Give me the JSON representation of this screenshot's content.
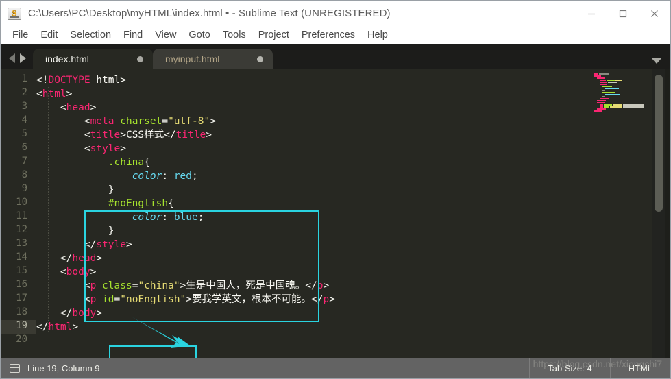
{
  "window": {
    "title": "C:\\Users\\PC\\Desktop\\myHTML\\index.html • - Sublime Text (UNREGISTERED)",
    "app_icon": "sublime-logo-icon",
    "controls": {
      "minimize": "minimize-icon",
      "maximize": "maximize-icon",
      "close": "close-icon"
    }
  },
  "menubar": {
    "items": [
      {
        "label": "File"
      },
      {
        "label": "Edit"
      },
      {
        "label": "Selection"
      },
      {
        "label": "Find"
      },
      {
        "label": "View"
      },
      {
        "label": "Goto"
      },
      {
        "label": "Tools"
      },
      {
        "label": "Project"
      },
      {
        "label": "Preferences"
      },
      {
        "label": "Help"
      }
    ]
  },
  "tabbar": {
    "nav_prev": "arrow-left-icon",
    "nav_next": "arrow-right-icon",
    "overflow": "chevron-down-icon",
    "tabs": [
      {
        "label": "index.html",
        "active": true,
        "dirty": true
      },
      {
        "label": "myinput.html",
        "active": false,
        "dirty": true
      }
    ]
  },
  "editor": {
    "active_line": 19,
    "total_lines": 20,
    "line_numbers": [
      "1",
      "2",
      "3",
      "4",
      "5",
      "6",
      "7",
      "8",
      "9",
      "10",
      "11",
      "12",
      "13",
      "14",
      "15",
      "16",
      "17",
      "18",
      "19",
      "20"
    ],
    "lines": [
      {
        "n": 1,
        "text": "<!DOCTYPE html>"
      },
      {
        "n": 2,
        "text": "<html>"
      },
      {
        "n": 3,
        "text": "    <head>"
      },
      {
        "n": 4,
        "text": "        <meta charset=\"utf-8\">"
      },
      {
        "n": 5,
        "text": "        <title>CSS样式</title>"
      },
      {
        "n": 6,
        "text": "        <style>"
      },
      {
        "n": 7,
        "text": "            .china{"
      },
      {
        "n": 8,
        "text": "                color: red;"
      },
      {
        "n": 9,
        "text": "            }"
      },
      {
        "n": 10,
        "text": "            #noEnglish{"
      },
      {
        "n": 11,
        "text": "                color: blue;"
      },
      {
        "n": 12,
        "text": "            }"
      },
      {
        "n": 13,
        "text": "        </style>"
      },
      {
        "n": 14,
        "text": "    </head>"
      },
      {
        "n": 15,
        "text": "    <body>"
      },
      {
        "n": 16,
        "text": "        <p class=\"china\">生是中国人，死是中国魂。</p>"
      },
      {
        "n": 17,
        "text": "        <p id=\"noEnglish\">要我学英文，根本不可能。</p>"
      },
      {
        "n": 18,
        "text": "    </body>"
      },
      {
        "n": 19,
        "text": "</html>"
      },
      {
        "n": 20,
        "text": ""
      }
    ]
  },
  "annotations": {
    "style_box_label": "style-block-highlight",
    "attr_box_label": "attribute-highlight",
    "arrow_label": "pointer-arrow",
    "color": "#2ad4e0"
  },
  "statusbar": {
    "layout_icon": "panel-layout-icon",
    "position": "Line 19, Column 9",
    "tab_size": "Tab Size: 4",
    "syntax": "HTML",
    "watermark": "https://blog.csdn.net/xiongchi7"
  },
  "colors": {
    "editor_bg": "#272822",
    "tag": "#f92672",
    "attribute": "#a6e22e",
    "string": "#e6db74",
    "property": "#66d9ef",
    "text": "#f8f8f2",
    "gutter": "#6f705f",
    "statusbar_bg": "#636363",
    "accent": "#2ad4e0"
  }
}
